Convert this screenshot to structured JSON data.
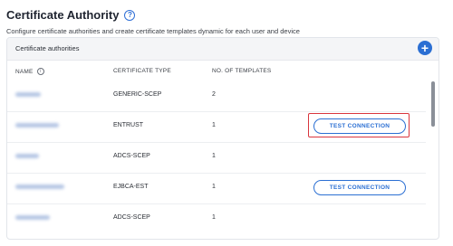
{
  "page": {
    "title": "Certificate Authority",
    "subtitle": "Configure certificate authorities and create certificate templates dynamic for each user and device"
  },
  "card": {
    "title": "Certificate authorities",
    "add_label": "+"
  },
  "table": {
    "columns": [
      "NAME",
      "CERTIFICATE TYPE",
      "NO. OF TEMPLATES"
    ],
    "rows": [
      {
        "type": "GENERIC-SCEP",
        "templates": "2",
        "action": ""
      },
      {
        "type": "ENTRUST",
        "templates": "1",
        "action": "TEST CONNECTION"
      },
      {
        "type": "ADCS-SCEP",
        "templates": "1",
        "action": ""
      },
      {
        "type": "EJBCA-EST",
        "templates": "1",
        "action": "TEST CONNECTION"
      },
      {
        "type": "ADCS-SCEP",
        "templates": "1",
        "action": ""
      }
    ]
  },
  "icons": {
    "help": "help-circle-icon",
    "info": "info-icon",
    "add": "plus-circle-icon"
  },
  "colors": {
    "accent": "#2b6fd3",
    "highlight": "#d9363e"
  }
}
